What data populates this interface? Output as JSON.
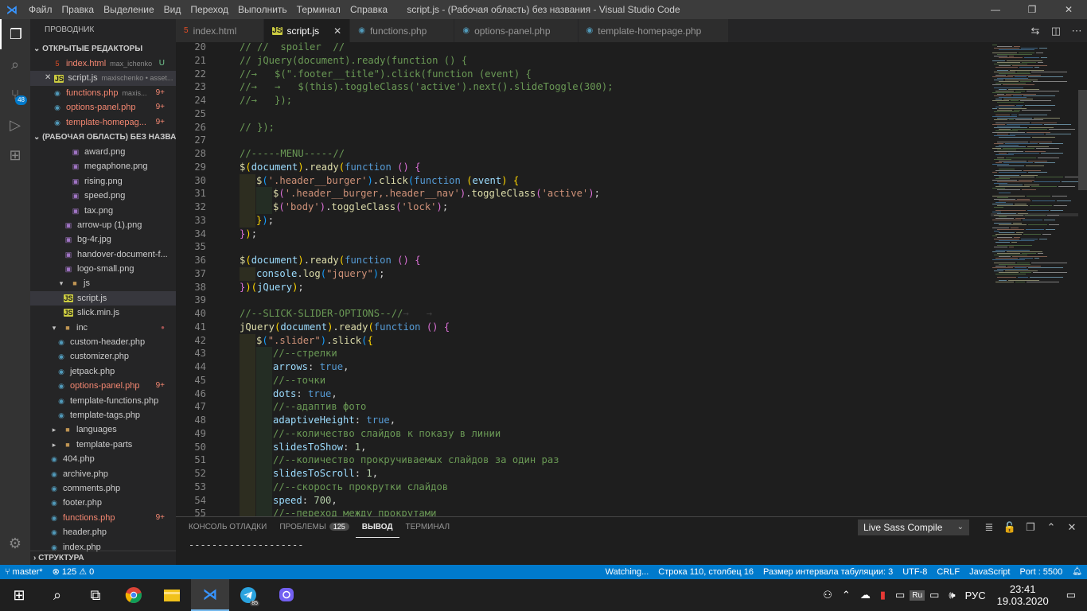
{
  "window": {
    "title": "script.js - (Рабочая область) без названия - Visual Studio Code",
    "menu": [
      "Файл",
      "Правка",
      "Выделение",
      "Вид",
      "Переход",
      "Выполнить",
      "Терминал",
      "Справка"
    ],
    "controls": [
      "—",
      "❐",
      "✕"
    ]
  },
  "activity": {
    "source_control_badge": "48"
  },
  "sidebar": {
    "title": "ПРОВОДНИК",
    "open_editors_title": "ОТКРЫТЫЕ РЕДАКТОРЫ",
    "open_editors": [
      {
        "name": "index.html",
        "desc": "max_ichenko",
        "dec": "U",
        "icon": "html",
        "red": true,
        "sel": false,
        "close": false
      },
      {
        "name": "script.js",
        "desc": "maxischenko • asset...",
        "dec": "",
        "icon": "js",
        "red": false,
        "sel": true,
        "close": true
      },
      {
        "name": "functions.php",
        "desc": "maxis...",
        "dec": "9+",
        "icon": "php",
        "red": true,
        "sel": false,
        "close": false
      },
      {
        "name": "options-panel.php",
        "desc": "",
        "dec": "9+",
        "icon": "php",
        "red": true,
        "sel": false,
        "close": false
      },
      {
        "name": "template-homepag...",
        "desc": "",
        "dec": "9+",
        "icon": "php",
        "red": true,
        "sel": false,
        "close": false
      }
    ],
    "workspace_title": "(РАБОЧАЯ ОБЛАСТЬ) БЕЗ НАЗВАН...",
    "tree": [
      {
        "name": "award.png",
        "indent": 3,
        "icon": "img"
      },
      {
        "name": "megaphone.png",
        "indent": 3,
        "icon": "img"
      },
      {
        "name": "rising.png",
        "indent": 3,
        "icon": "img"
      },
      {
        "name": "speed.png",
        "indent": 3,
        "icon": "img"
      },
      {
        "name": "tax.png",
        "indent": 3,
        "icon": "img"
      },
      {
        "name": "arrow-up (1).png",
        "indent": 2,
        "icon": "img"
      },
      {
        "name": "bg-4r.jpg",
        "indent": 2,
        "icon": "img"
      },
      {
        "name": "handover-document-f...",
        "indent": 2,
        "icon": "img"
      },
      {
        "name": "logo-small.png",
        "indent": 2,
        "icon": "img"
      },
      {
        "name": "js",
        "indent": 1,
        "icon": "folder-open"
      },
      {
        "name": "script.js",
        "indent": 2,
        "icon": "js",
        "sel": true
      },
      {
        "name": "slick.min.js",
        "indent": 2,
        "icon": "js"
      },
      {
        "name": "inc",
        "indent": 0,
        "icon": "folder-open",
        "dot": true
      },
      {
        "name": "custom-header.php",
        "indent": 1,
        "icon": "php"
      },
      {
        "name": "customizer.php",
        "indent": 1,
        "icon": "php"
      },
      {
        "name": "jetpack.php",
        "indent": 1,
        "icon": "php"
      },
      {
        "name": "options-panel.php",
        "indent": 1,
        "icon": "php",
        "red": true,
        "dec": "9+"
      },
      {
        "name": "template-functions.php",
        "indent": 1,
        "icon": "php"
      },
      {
        "name": "template-tags.php",
        "indent": 1,
        "icon": "php"
      },
      {
        "name": "languages",
        "indent": 0,
        "icon": "folder"
      },
      {
        "name": "template-parts",
        "indent": 0,
        "icon": "folder"
      },
      {
        "name": "404.php",
        "indent": 0,
        "icon": "php"
      },
      {
        "name": "archive.php",
        "indent": 0,
        "icon": "php"
      },
      {
        "name": "comments.php",
        "indent": 0,
        "icon": "php"
      },
      {
        "name": "footer.php",
        "indent": 0,
        "icon": "php"
      },
      {
        "name": "functions.php",
        "indent": 0,
        "icon": "php",
        "red": true,
        "dec": "9+"
      },
      {
        "name": "header.php",
        "indent": 0,
        "icon": "php"
      },
      {
        "name": "index.php",
        "indent": 0,
        "icon": "php"
      }
    ],
    "structure_title": "СТРУКТУРА"
  },
  "tabs": [
    {
      "label": "index.html",
      "icon": "html",
      "active": false
    },
    {
      "label": "script.js",
      "icon": "js",
      "active": true
    },
    {
      "label": "functions.php",
      "icon": "php",
      "active": false
    },
    {
      "label": "options-panel.php",
      "icon": "php",
      "active": false
    },
    {
      "label": "template-homepage.php",
      "icon": "php",
      "active": false
    }
  ],
  "editor": {
    "first_line": 20,
    "lines": [
      {
        "ind": 0,
        "t": [
          [
            "c",
            "// //  spoiler  //"
          ]
        ]
      },
      {
        "ind": 0,
        "t": [
          [
            "c",
            "// jQuery(document).ready(function () {"
          ]
        ]
      },
      {
        "ind": 0,
        "t": [
          [
            "c",
            "//→   $(\".footer__title\").click(function (event) {"
          ]
        ]
      },
      {
        "ind": 0,
        "t": [
          [
            "c",
            "//→   →   $(this).toggleClass('active').next().slideToggle(300);"
          ]
        ]
      },
      {
        "ind": 0,
        "t": [
          [
            "c",
            "//→   });"
          ]
        ]
      },
      {
        "ind": 0,
        "t": []
      },
      {
        "ind": 0,
        "t": [
          [
            "c",
            "// });"
          ]
        ]
      },
      {
        "ind": 0,
        "t": []
      },
      {
        "ind": 0,
        "t": [
          [
            "c",
            "//-----MENU-----//"
          ]
        ]
      },
      {
        "ind": 0,
        "t": [
          [
            "f",
            "$"
          ],
          [
            "b1",
            "("
          ],
          [
            "p",
            "document"
          ],
          [
            "b1",
            ")"
          ],
          [
            "d",
            "."
          ],
          [
            "f",
            "ready"
          ],
          [
            "b1",
            "("
          ],
          [
            "k",
            "function"
          ],
          [
            "d",
            " "
          ],
          [
            "b2",
            "()"
          ],
          [
            "d",
            " "
          ],
          [
            "b2",
            "{"
          ]
        ]
      },
      {
        "ind": 1,
        "t": [
          [
            "f",
            "$"
          ],
          [
            "b3",
            "("
          ],
          [
            "s",
            "'.header__burger'"
          ],
          [
            "b3",
            ")"
          ],
          [
            "d",
            "."
          ],
          [
            "f",
            "click"
          ],
          [
            "b3",
            "("
          ],
          [
            "k",
            "function"
          ],
          [
            "d",
            " "
          ],
          [
            "b1",
            "("
          ],
          [
            "p",
            "event"
          ],
          [
            "b1",
            ")"
          ],
          [
            "d",
            " "
          ],
          [
            "b1",
            "{"
          ]
        ]
      },
      {
        "ind": 2,
        "t": [
          [
            "f",
            "$"
          ],
          [
            "b2",
            "("
          ],
          [
            "s",
            "'.header__burger,.header__nav'"
          ],
          [
            "b2",
            ")"
          ],
          [
            "d",
            "."
          ],
          [
            "f",
            "toggleClass"
          ],
          [
            "b2",
            "("
          ],
          [
            "s",
            "'active'"
          ],
          [
            "b2",
            ")"
          ],
          [
            "d",
            ";"
          ]
        ]
      },
      {
        "ind": 2,
        "t": [
          [
            "f",
            "$"
          ],
          [
            "b2",
            "("
          ],
          [
            "s",
            "'body'"
          ],
          [
            "b2",
            ")"
          ],
          [
            "d",
            "."
          ],
          [
            "f",
            "toggleClass"
          ],
          [
            "b2",
            "("
          ],
          [
            "s",
            "'lock'"
          ],
          [
            "b2",
            ")"
          ],
          [
            "d",
            ";"
          ]
        ]
      },
      {
        "ind": 1,
        "t": [
          [
            "b1",
            "}"
          ],
          [
            "b3",
            ")"
          ],
          [
            "d",
            ";"
          ]
        ]
      },
      {
        "ind": 0,
        "t": [
          [
            "b2",
            "}"
          ],
          [
            "b1",
            ")"
          ],
          [
            "d",
            ";"
          ]
        ]
      },
      {
        "ind": 0,
        "t": []
      },
      {
        "ind": 0,
        "t": [
          [
            "f",
            "$"
          ],
          [
            "b1",
            "("
          ],
          [
            "p",
            "document"
          ],
          [
            "b1",
            ")"
          ],
          [
            "d",
            "."
          ],
          [
            "f",
            "ready"
          ],
          [
            "b1",
            "("
          ],
          [
            "k",
            "function"
          ],
          [
            "d",
            " "
          ],
          [
            "b2",
            "()"
          ],
          [
            "d",
            " "
          ],
          [
            "b2",
            "{"
          ]
        ]
      },
      {
        "ind": 1,
        "t": [
          [
            "p",
            "console"
          ],
          [
            "d",
            "."
          ],
          [
            "f",
            "log"
          ],
          [
            "b3",
            "("
          ],
          [
            "s",
            "\"jquery\""
          ],
          [
            "b3",
            ")"
          ],
          [
            "d",
            ";"
          ]
        ]
      },
      {
        "ind": 0,
        "t": [
          [
            "b2",
            "}"
          ],
          [
            "b1",
            ")("
          ],
          [
            "p",
            "jQuery"
          ],
          [
            "b1",
            ")"
          ],
          [
            "d",
            ";"
          ]
        ]
      },
      {
        "ind": 0,
        "t": []
      },
      {
        "ind": 0,
        "t": [
          [
            "c",
            "//--SLICK-SLIDER-OPTIONS--//"
          ],
          [
            "w",
            "→   →"
          ]
        ]
      },
      {
        "ind": 0,
        "t": [
          [
            "f",
            "jQuery"
          ],
          [
            "b1",
            "("
          ],
          [
            "p",
            "document"
          ],
          [
            "b1",
            ")"
          ],
          [
            "d",
            "."
          ],
          [
            "f",
            "ready"
          ],
          [
            "b1",
            "("
          ],
          [
            "k",
            "function"
          ],
          [
            "d",
            " "
          ],
          [
            "b2",
            "()"
          ],
          [
            "d",
            " "
          ],
          [
            "b2",
            "{"
          ]
        ]
      },
      {
        "ind": 1,
        "t": [
          [
            "f",
            "$"
          ],
          [
            "b3",
            "("
          ],
          [
            "s",
            "\".slider\""
          ],
          [
            "b3",
            ")"
          ],
          [
            "d",
            "."
          ],
          [
            "f",
            "slick"
          ],
          [
            "b3",
            "("
          ],
          [
            "b1",
            "{"
          ]
        ]
      },
      {
        "ind": 2,
        "t": [
          [
            "c",
            "//--стрелки"
          ]
        ]
      },
      {
        "ind": 2,
        "t": [
          [
            "p",
            "arrows"
          ],
          [
            "d",
            ": "
          ],
          [
            "k",
            "true"
          ],
          [
            "d",
            ","
          ]
        ]
      },
      {
        "ind": 2,
        "t": [
          [
            "c",
            "//--точки"
          ]
        ]
      },
      {
        "ind": 2,
        "t": [
          [
            "p",
            "dots"
          ],
          [
            "d",
            ": "
          ],
          [
            "k",
            "true"
          ],
          [
            "d",
            ","
          ]
        ]
      },
      {
        "ind": 2,
        "t": [
          [
            "c",
            "//--адаптив фото"
          ]
        ]
      },
      {
        "ind": 2,
        "t": [
          [
            "p",
            "adaptiveHeight"
          ],
          [
            "d",
            ": "
          ],
          [
            "k",
            "true"
          ],
          [
            "d",
            ","
          ]
        ]
      },
      {
        "ind": 2,
        "t": [
          [
            "c",
            "//--количество слайдов к показу в линии"
          ]
        ]
      },
      {
        "ind": 2,
        "t": [
          [
            "p",
            "slidesToShow"
          ],
          [
            "d",
            ": "
          ],
          [
            "s2",
            "1"
          ],
          [
            "d",
            ","
          ]
        ]
      },
      {
        "ind": 2,
        "t": [
          [
            "c",
            "//--количество прокручиваемых слайдов за один раз"
          ]
        ]
      },
      {
        "ind": 2,
        "t": [
          [
            "p",
            "slidesToScroll"
          ],
          [
            "d",
            ": "
          ],
          [
            "s2",
            "1"
          ],
          [
            "d",
            ","
          ]
        ]
      },
      {
        "ind": 2,
        "t": [
          [
            "c",
            "//--скорость прокрутки слайдов"
          ]
        ]
      },
      {
        "ind": 2,
        "t": [
          [
            "p",
            "speed"
          ],
          [
            "d",
            ": "
          ],
          [
            "s2",
            "700"
          ],
          [
            "d",
            ","
          ]
        ]
      },
      {
        "ind": 2,
        "t": [
          [
            "c",
            "//--переход между прокрутами"
          ]
        ]
      }
    ]
  },
  "panel": {
    "tabs": [
      {
        "label": "КОНСОЛЬ ОТЛАДКИ",
        "active": false
      },
      {
        "label": "ПРОБЛЕМЫ",
        "active": false,
        "badge": "125"
      },
      {
        "label": "ВЫВОД",
        "active": true
      },
      {
        "label": "ТЕРМИНАЛ",
        "active": false
      }
    ],
    "output_channel": "Live Sass Compile",
    "output_text": "--------------------"
  },
  "statusbar": {
    "left": [
      "master*",
      "⊗ 125 ⚠ 0"
    ],
    "right": [
      "Watching...",
      "Строка 110, столбец 16",
      "Размер интервала табуляции: 3",
      "UTF-8",
      "CRLF",
      "JavaScript",
      "Port : 5500"
    ]
  },
  "taskbar": {
    "telegram_badge": "85",
    "lang": "РУС",
    "kb": "Ru",
    "time": "23:41",
    "date": "19.03.2020"
  },
  "colors": {
    "accent": "#007acc",
    "error_text": "#f48771"
  }
}
